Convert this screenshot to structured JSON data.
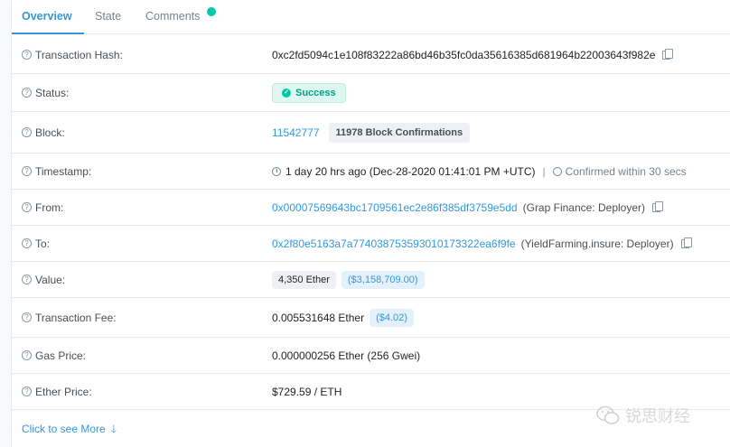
{
  "tabs": [
    {
      "label": "Overview"
    },
    {
      "label": "State"
    },
    {
      "label": "Comments"
    }
  ],
  "rows": {
    "tx_hash": {
      "label": "Transaction Hash:",
      "value": "0xc2fd5094c1e108f83222a86bd46b35fc0da35616385d681964b22003643f982e"
    },
    "status": {
      "label": "Status:",
      "value": "Success"
    },
    "block": {
      "label": "Block:",
      "value": "11542777",
      "confirmations": "11978 Block Confirmations"
    },
    "timestamp": {
      "label": "Timestamp:",
      "value": "1 day 20 hrs ago (Dec-28-2020 01:41:01 PM +UTC)",
      "separator": "|",
      "confirmed": "Confirmed within 30 secs"
    },
    "from": {
      "label": "From:",
      "address": "0x00007569643bc1709561ec2e86f385df3759e5dd",
      "name": "(Grap Finance: Deployer)"
    },
    "to": {
      "label": "To:",
      "address": "0x2f80e5163a7a774038753593010173322ea6f9fe",
      "name": "(YieldFarming.insure: Deployer)"
    },
    "value": {
      "label": "Value:",
      "amount": "4,350 Ether",
      "usd": "($3,158,709.00)"
    },
    "fee": {
      "label": "Transaction Fee:",
      "amount": "0.005531648 Ether",
      "usd": "($4.02)"
    },
    "gas": {
      "label": "Gas Price:",
      "value": "0.000000256 Ether (256 Gwei)"
    },
    "ether_price": {
      "label": "Ether Price:",
      "value": "$729.59 / ETH"
    }
  },
  "more": {
    "label": "Click to see More",
    "arrow": "🡓"
  },
  "watermark": {
    "text": "锐思财经"
  },
  "colors": {
    "link": "#3498db",
    "success": "#00c9a7",
    "border": "#e7eaf3"
  }
}
